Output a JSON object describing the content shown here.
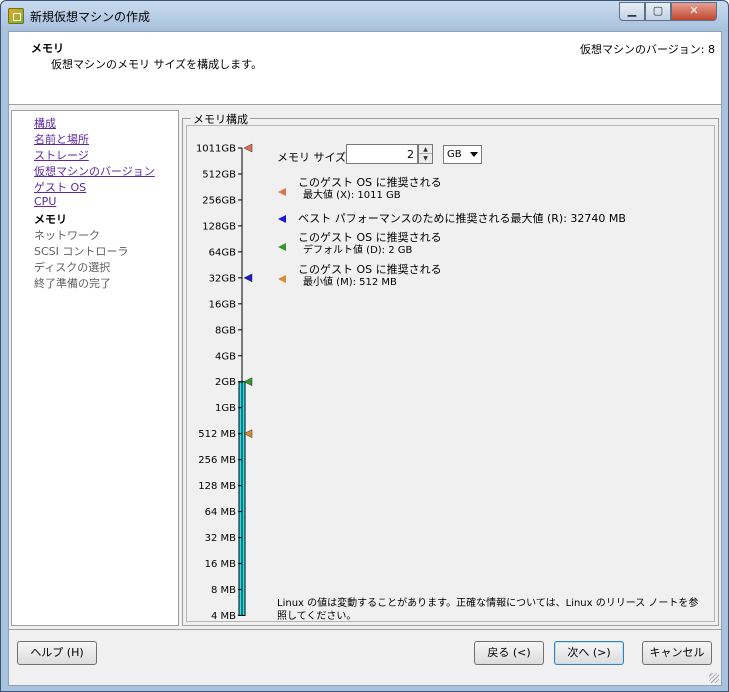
{
  "window": {
    "title": "新規仮想マシンの作成",
    "caption_buttons": {
      "minimize": "▁",
      "maximize": "▢",
      "close": "✕"
    }
  },
  "header": {
    "title": "メモリ",
    "subtitle": "仮想マシンのメモリ サイズを構成します。",
    "vm_version": "仮想マシンのバージョン: 8"
  },
  "nav": {
    "items": [
      {
        "label": "構成",
        "state": "link"
      },
      {
        "label": "名前と場所",
        "state": "link"
      },
      {
        "label": "ストレージ",
        "state": "link"
      },
      {
        "label": "仮想マシンのバージョン",
        "state": "link"
      },
      {
        "label": "ゲスト OS",
        "state": "link"
      },
      {
        "label": "CPU",
        "state": "link"
      },
      {
        "label": "メモリ",
        "state": "current"
      },
      {
        "label": "ネットワーク",
        "state": "future"
      },
      {
        "label": "SCSI コントローラ",
        "state": "future"
      },
      {
        "label": "ディスクの選択",
        "state": "future"
      },
      {
        "label": "終了準備の完了",
        "state": "future"
      }
    ]
  },
  "memory": {
    "group_label": "メモリ構成",
    "size_label": "メモリ サイズ:",
    "size_value": "2",
    "unit_selected": "GB",
    "scale_labels": [
      "1011GB",
      "512GB",
      "256GB",
      "128GB",
      "64GB",
      "32GB",
      "16GB",
      "8GB",
      "4GB",
      "2GB",
      "1GB",
      "512 MB",
      "256 MB",
      "128 MB",
      "64 MB",
      "32 MB",
      "16 MB",
      "8 MB",
      "4 MB"
    ],
    "current_level_label": "2GB",
    "bar_color": "#1ee8f2",
    "markers": [
      {
        "label": "1011GB",
        "color": "#e07050"
      },
      {
        "label": "32GB",
        "color": "#1a1ad0"
      },
      {
        "label": "2GB",
        "color": "#2e9a2e"
      },
      {
        "label": "512 MB",
        "color": "#d88a30"
      }
    ],
    "legend": {
      "max": {
        "line1": "このゲスト OS に推奨される",
        "line2": "最大値 (X): 1011 GB",
        "color": "#e07050"
      },
      "best": {
        "line1": "ベスト パフォーマンスのために推奨される最大値 (R): 32740 MB",
        "color": "#1a1ad0"
      },
      "default": {
        "line1": "このゲスト OS に推奨される",
        "line2": "デフォルト値 (D): 2 GB",
        "color": "#2e9a2e"
      },
      "min": {
        "line1": "このゲスト OS に推奨される",
        "line2": "最小値 (M): 512 MB",
        "color": "#d88a30"
      }
    },
    "note": "Linux の値は変動することがあります。正確な情報については、Linux のリリース ノートを参照してください。"
  },
  "buttons": {
    "help": "ヘルプ (H)",
    "back": "戻る (<)",
    "next": "次へ (>)",
    "cancel": "キャンセル"
  }
}
